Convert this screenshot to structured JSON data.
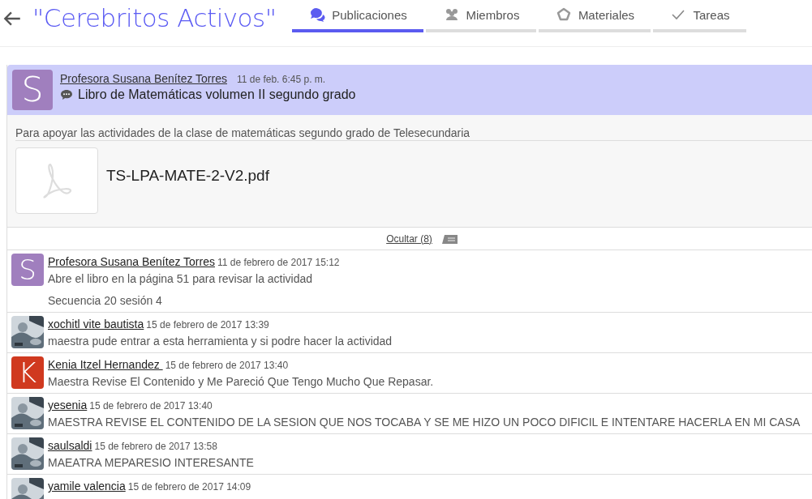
{
  "header": {
    "title": "\"Cerebritos Activos\""
  },
  "tabs": [
    {
      "label": "Publicaciones",
      "selected": true
    },
    {
      "label": "Miembros",
      "selected": false
    },
    {
      "label": "Materiales",
      "selected": false
    },
    {
      "label": "Tareas",
      "selected": false
    }
  ],
  "post": {
    "avatar": {
      "kind": "letter",
      "letter": "S",
      "color": "#a07fbe"
    },
    "author": "Profesora Susana Benítez Torres",
    "time": "11 de feb. 6:45 p. m.",
    "title": "Libro de Matemáticas volumen II segundo grado",
    "description": "Para apoyar las actividades de la clase de matemáticas segundo grado de Telesecundaria",
    "attachment": {
      "name": "TS-LPA-MATE-2-V2.pdf"
    },
    "toggle": "Ocultar (8)"
  },
  "comments": [
    {
      "avatar": {
        "kind": "letter",
        "letter": "S",
        "color": "#a07fbe"
      },
      "author": "Profesora Susana Benítez Torres",
      "date": "11 de febrero de 2017 15:12",
      "paragraphs": [
        "Abre el libro en la página 51 para revisar la actividad",
        "Secuencia 20 sesión 4"
      ]
    },
    {
      "avatar": {
        "kind": "picture"
      },
      "author": "xochitl vite bautista",
      "date": "15 de febrero de 2017 13:39",
      "paragraphs": [
        "maestra pude entrar a esta herramienta y si podre hacer la actividad"
      ]
    },
    {
      "avatar": {
        "kind": "letter",
        "letter": "K",
        "color": "#d0391f"
      },
      "author": "Kenia Itzel Hernandez ",
      "date": "15 de febrero de 2017 13:40",
      "paragraphs": [
        "Maestra Revise El Contenido y Me Pareció Que Tengo Mucho Que Repasar."
      ]
    },
    {
      "avatar": {
        "kind": "picture"
      },
      "author": "yesenia",
      "date": "15 de febrero de 2017 13:40",
      "paragraphs": [
        "MAESTRA REVISE EL CONTENIDO DE LA SESION QUE NOS TOCABA Y SE ME HIZO UN POCO DIFICIL E INTENTARE HACERLA EN MI CASA"
      ]
    },
    {
      "avatar": {
        "kind": "picture"
      },
      "author": "saulsaldi",
      "date": "15 de febrero de 2017 13:58",
      "paragraphs": [
        "MAEATRA MEPARESIO INTERESANTE"
      ]
    },
    {
      "avatar": {
        "kind": "picture"
      },
      "author": "yamile valencia",
      "date": "15 de febrero de 2017 14:09"
    }
  ]
}
